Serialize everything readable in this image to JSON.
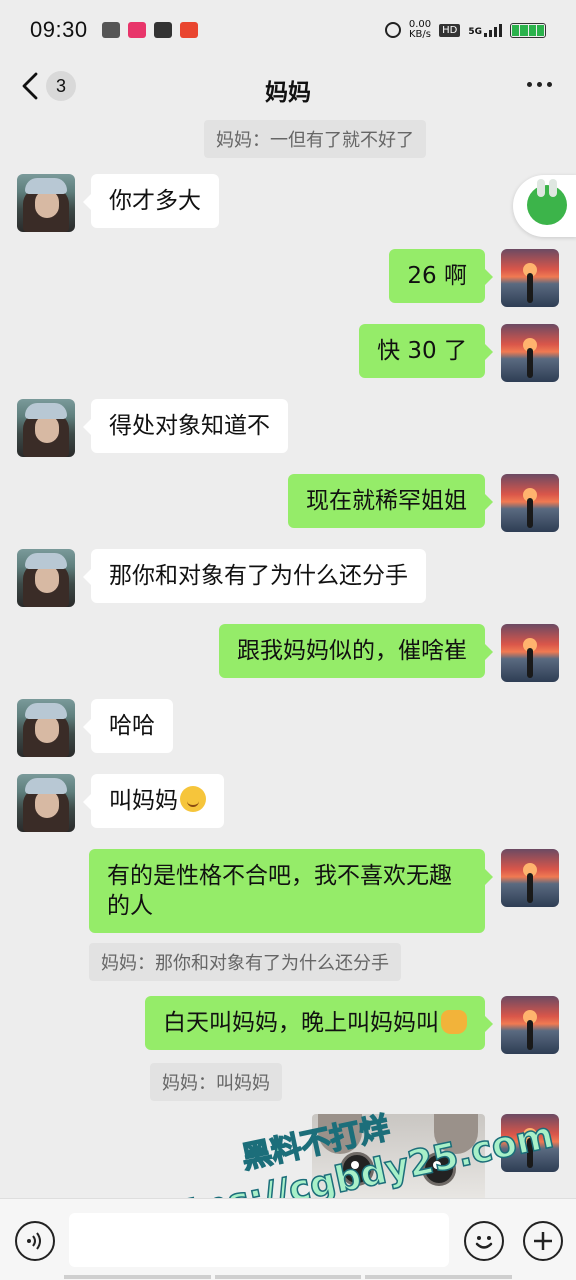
{
  "status_bar": {
    "time": "09:30",
    "net_speed_value": "0.00",
    "net_speed_unit": "KB/s",
    "hd_label": "HD",
    "signal_label": "5G"
  },
  "header": {
    "back_unread_count": "3",
    "title": "妈妈",
    "more_icon": "more-dots-icon"
  },
  "messages": [
    {
      "type": "quote",
      "text": "妈妈：一但有了就不好了"
    },
    {
      "side": "left",
      "text": "你才多大"
    },
    {
      "side": "right",
      "text": "26 啊"
    },
    {
      "side": "right",
      "text": "快 30 了"
    },
    {
      "side": "left",
      "text": "得处对象知道不"
    },
    {
      "side": "right",
      "text": "现在就稀罕姐姐"
    },
    {
      "side": "left",
      "text": "那你和对象有了为什么还分手"
    },
    {
      "side": "right",
      "text": "跟我妈妈似的，催啥崔"
    },
    {
      "side": "left",
      "text": "哈哈"
    },
    {
      "side": "left",
      "text": "叫妈妈",
      "emoji": "blushing-emoji"
    },
    {
      "side": "right",
      "text_line1": "有的是性格不合吧，我不喜欢无趣",
      "text_line2": "的人"
    },
    {
      "type": "quote",
      "text": "妈妈：那你和对象有了为什么还分手"
    },
    {
      "side": "right",
      "text": "白天叫妈妈，晚上叫妈妈叫",
      "emoji": "cat-emoji"
    },
    {
      "type": "quote",
      "text": "妈妈：叫妈妈"
    },
    {
      "side": "right",
      "type": "image",
      "image": "cat-photo"
    }
  ],
  "watermark": {
    "line1": "黑料不打烊",
    "line2": "https://cgbdy25.com"
  },
  "input_bar": {
    "voice_icon": "voice-icon",
    "emoji_icon": "emoji-face-icon",
    "plus_icon": "plus-icon",
    "input_value": ""
  },
  "colors": {
    "background": "#ededed",
    "bubble_self": "#95ec69",
    "bubble_other": "#ffffff"
  }
}
